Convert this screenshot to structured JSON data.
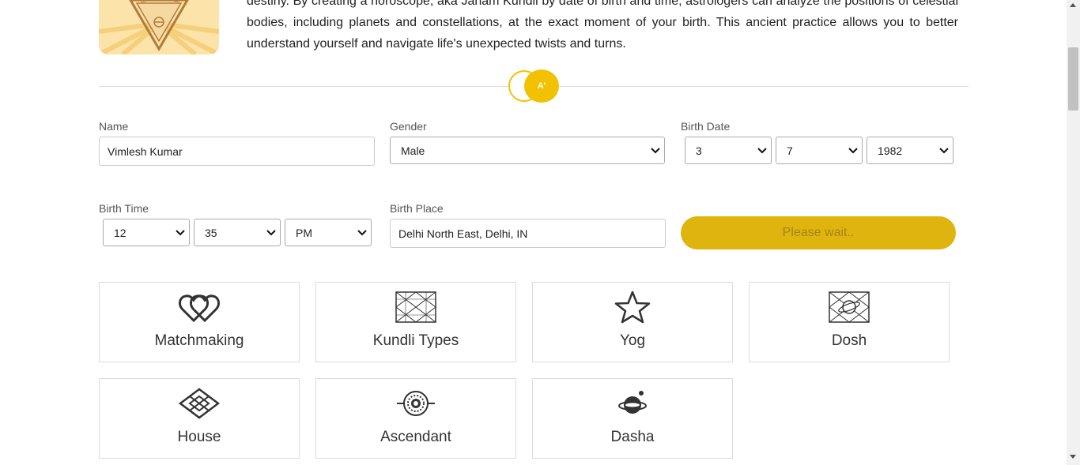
{
  "intro": {
    "text": "destiny. By creating a horoscope, aka Janam Kundli by date of birth and time, astrologers can analyze the positions of celestial bodies, including planets and constellations, at the exact moment of your birth. This ancient practice allows you to better understand yourself and navigate life's unexpected twists and turns."
  },
  "badge": {
    "text": "A'"
  },
  "form": {
    "name": {
      "label": "Name",
      "value": "Vimlesh Kumar"
    },
    "gender": {
      "label": "Gender",
      "value": "Male"
    },
    "birth_date": {
      "label": "Birth Date",
      "day": "3",
      "month": "7",
      "year": "1982"
    },
    "birth_time": {
      "label": "Birth Time",
      "hour": "12",
      "minute": "35",
      "ampm": "PM"
    },
    "birth_place": {
      "label": "Birth Place",
      "value": "Delhi North East, Delhi, IN"
    },
    "submit_label": "Please wait.."
  },
  "cards": [
    {
      "label": "Matchmaking",
      "icon": "linked-hearts-icon"
    },
    {
      "label": "Kundli Types",
      "icon": "kundli-grid-icon"
    },
    {
      "label": "Yog",
      "icon": "star-icon"
    },
    {
      "label": "Dosh",
      "icon": "planet-grid-icon"
    },
    {
      "label": "House",
      "icon": "diamond-house-icon"
    },
    {
      "label": "Ascendant",
      "icon": "ascendant-icon"
    },
    {
      "label": "Dasha",
      "icon": "planet-icon"
    }
  ],
  "colors": {
    "accent": "#f2c100",
    "button": "#e0b40f",
    "button_text": "#a58511"
  }
}
